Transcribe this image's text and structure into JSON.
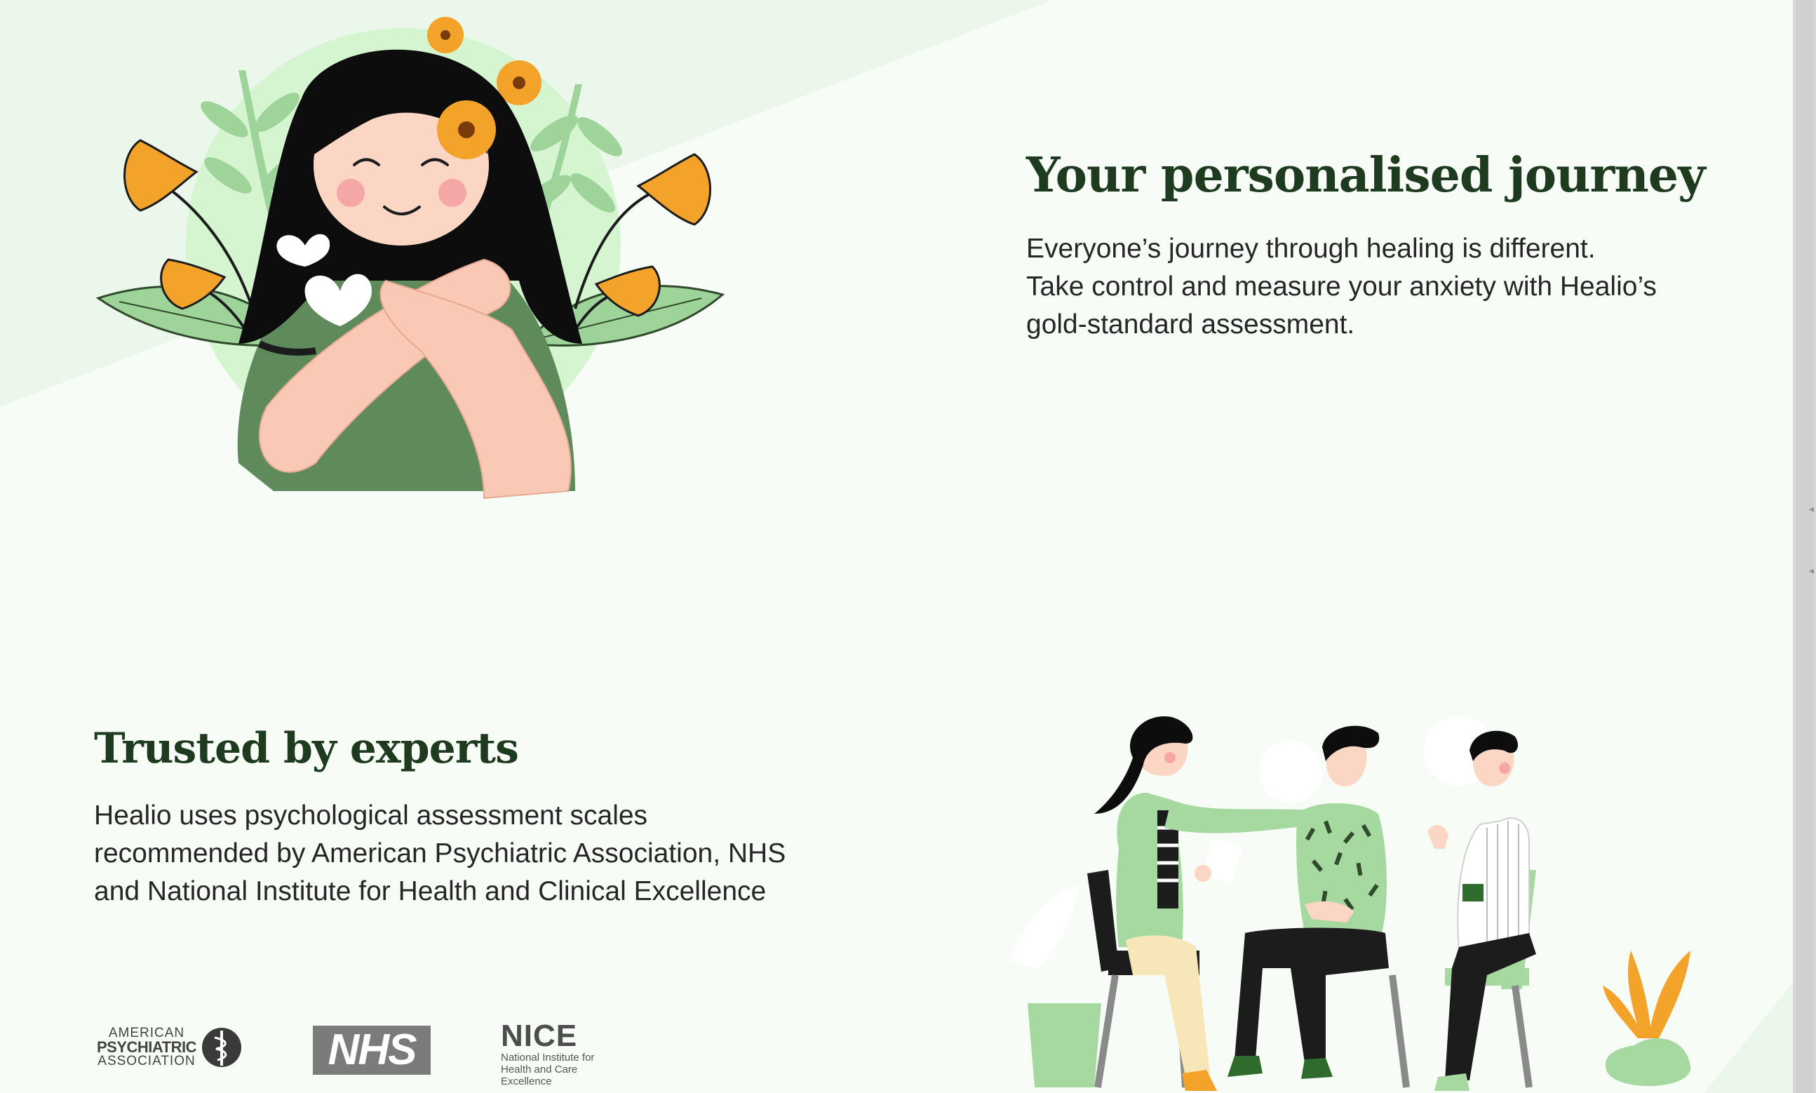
{
  "journey": {
    "title": "Your personalised journey",
    "lines": [
      "Everyone’s journey through healing is different.",
      "Take control and measure your anxiety with Healio’s",
      "gold-standard assessment."
    ]
  },
  "experts": {
    "title": "Trusted by experts",
    "lines": [
      "Healio uses psychological assessment scales",
      "recommended by American Psychiatric Association, NHS",
      "and National Institute for Health and Clinical Excellence"
    ]
  },
  "logos": {
    "apa": {
      "line1": "AMERICAN",
      "line2": "PSYCHIATRIC",
      "line3": "ASSOCIATION"
    },
    "nhs": "NHS",
    "nice": {
      "word": "NICE",
      "sub1": "National Institute for",
      "sub2": "Health and Care Excellence"
    }
  },
  "colors": {
    "background": "#f7fcf7",
    "band": "#ecf8ec",
    "title": "#1e3b20",
    "accent_green": "#5e8a5c",
    "light_green": "#a6d9a0",
    "orange": "#f4a32a"
  },
  "icons": {
    "hero": "woman-hugging-self-illustration",
    "group": "group-therapy-illustration",
    "apa_emblem": "apa-caduceus-icon"
  }
}
